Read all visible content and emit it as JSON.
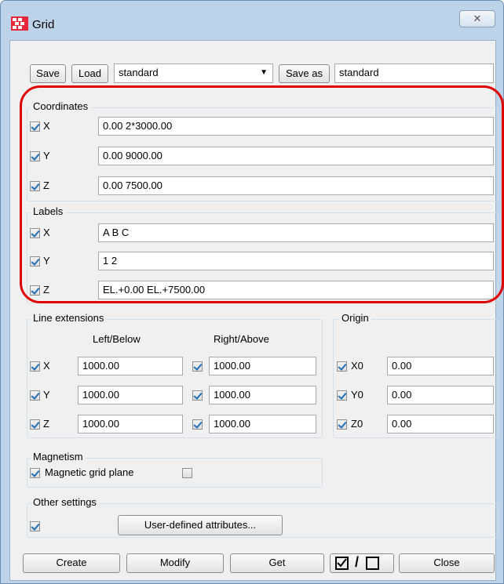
{
  "window": {
    "title": "Grid",
    "close_glyph": "✕"
  },
  "toolbar": {
    "save_label": "Save",
    "load_label": "Load",
    "preset_value": "standard",
    "saveas_label": "Save as",
    "saveas_value": "standard"
  },
  "coordinates": {
    "title": "Coordinates",
    "x": {
      "label": "X",
      "checked": true,
      "value": "0.00 2*3000.00"
    },
    "y": {
      "label": "Y",
      "checked": true,
      "value": "0.00 9000.00"
    },
    "z": {
      "label": "Z",
      "checked": true,
      "value": "0.00 7500.00"
    }
  },
  "labels": {
    "title": "Labels",
    "x": {
      "label": "X",
      "checked": true,
      "value": "A B C"
    },
    "y": {
      "label": "Y",
      "checked": true,
      "value": "1 2"
    },
    "z": {
      "label": "Z",
      "checked": true,
      "value": "EL.+0.00 EL.+7500.00"
    }
  },
  "line_extensions": {
    "title": "Line extensions",
    "left_header": "Left/Below",
    "right_header": "Right/Above",
    "x": {
      "label": "X",
      "left": "1000.00",
      "right": "1000.00"
    },
    "y": {
      "label": "Y",
      "left": "1000.00",
      "right": "1000.00"
    },
    "z": {
      "label": "Z",
      "left": "1000.00",
      "right": "1000.00"
    }
  },
  "origin": {
    "title": "Origin",
    "x0": {
      "label": "X0",
      "value": "0.00"
    },
    "y0": {
      "label": "Y0",
      "value": "0.00"
    },
    "z0": {
      "label": "Z0",
      "value": "0.00"
    }
  },
  "magnetism": {
    "title": "Magnetism",
    "magnetic_label": "Magnetic grid plane",
    "magnetic_checked": true,
    "extra_checked": false
  },
  "other": {
    "title": "Other settings",
    "checked": true,
    "uda_label": "User-defined attributes..."
  },
  "footer": {
    "create_label": "Create",
    "modify_label": "Modify",
    "get_label": "Get",
    "close_label": "Close"
  },
  "colors": {
    "highlight": "#e00000",
    "accent_check": "#1f6fb6",
    "window_frame": "#bdd3ea"
  }
}
